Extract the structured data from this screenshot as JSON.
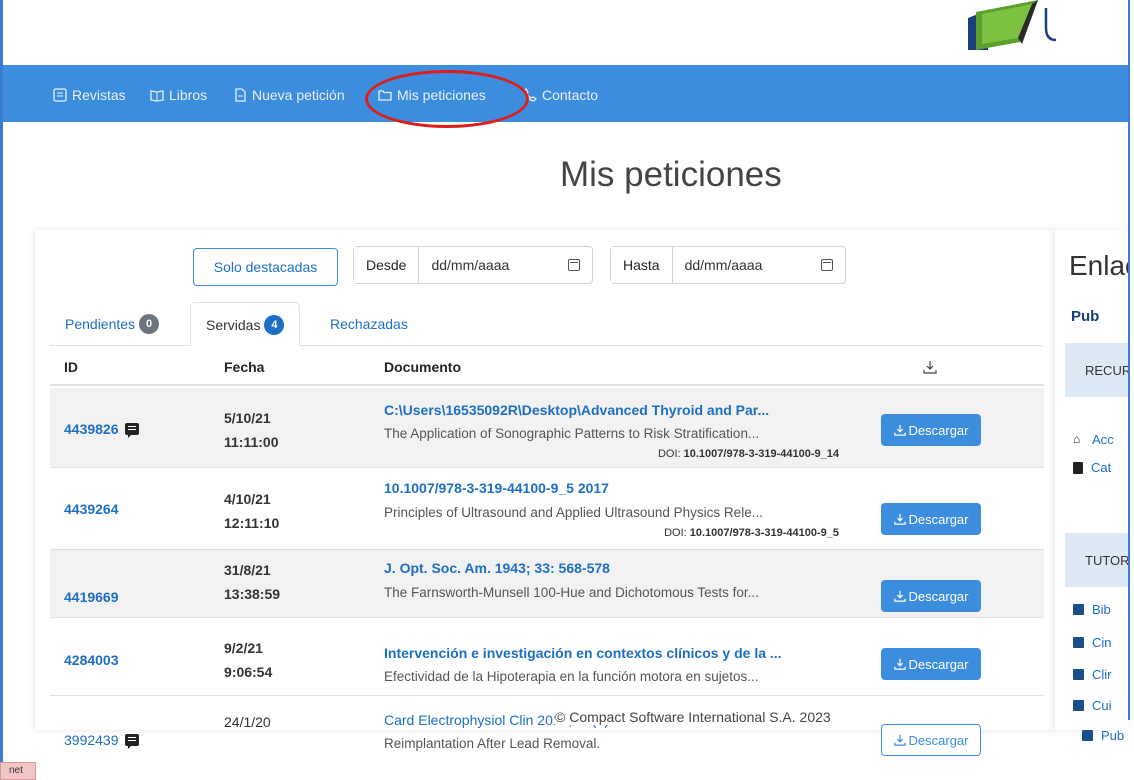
{
  "nav": {
    "items": [
      {
        "label": "Revistas",
        "icon": "journal-icon"
      },
      {
        "label": "Libros",
        "icon": "book-open-icon"
      },
      {
        "label": "Nueva petición",
        "icon": "file-icon"
      },
      {
        "label": "Mis peticiones",
        "icon": "folder-icon"
      },
      {
        "label": "Contacto",
        "icon": "phone-icon"
      }
    ]
  },
  "page": {
    "title": "Mis peticiones"
  },
  "filters": {
    "solo_destacadas": "Solo destacadas",
    "desde_label": "Desde",
    "desde_placeholder": "dd/mm/aaaa",
    "hasta_label": "Hasta",
    "hasta_placeholder": "dd/mm/aaaa"
  },
  "tabs": [
    {
      "label": "Pendientes",
      "count": "0"
    },
    {
      "label": "Servidas",
      "count": "4"
    },
    {
      "label": "Rechazadas",
      "count": ""
    }
  ],
  "table": {
    "headers": {
      "id": "ID",
      "fecha": "Fecha",
      "documento": "Documento"
    },
    "download_label": "Descargar",
    "rows": [
      {
        "id": "4439826",
        "date": "5/10/21",
        "time": "11:11:00",
        "title": "C:\\Users\\16535092R\\Desktop\\Advanced Thyroid and Par...",
        "subtitle": "The Application of Sonographic Patterns to Risk Stratification...",
        "doi_label": "DOI:",
        "doi": "10.1007/978-3-319-44100-9_14"
      },
      {
        "id": "4439264",
        "date": "4/10/21",
        "time": "12:11:10",
        "title": "10.1007/978-3-319-44100-9_5 2017",
        "subtitle": "Principles of Ultrasound and Applied Ultrasound Physics Rele...",
        "doi_label": "DOI:",
        "doi": "10.1007/978-3-319-44100-9_5"
      },
      {
        "id": "4419669",
        "date": "31/8/21",
        "time": "13:38:59",
        "title": "J. Opt. Soc. Am. 1943; 33: 568-578",
        "subtitle": "The Farnsworth-Munsell 100-Hue and Dichotomous Tests for..."
      },
      {
        "id": "4284003",
        "date": "9/2/21",
        "time": "9:06:54",
        "title": "Intervención e investigación en contextos clínicos y de la ...",
        "subtitle": "Efectividad de la Hipoterapia en la función motora en sujetos..."
      },
      {
        "id": "3992439",
        "date": "24/1/20",
        "time": "",
        "title": "Card Electrophysiol Clin 2018; 10(4): 667-674",
        "subtitle": "Reimplantation After Lead Removal."
      }
    ]
  },
  "sidebar": {
    "title": "Enlac",
    "pub": "Pub",
    "band1": "RECUR",
    "links1": [
      "Acc",
      "Cat"
    ],
    "band2": "TUTOR",
    "links2": [
      "Bib",
      "Cin",
      "Clir",
      "Cui",
      "Pub"
    ]
  },
  "footer": {
    "text": "© Compact Software International S.A. 2023"
  },
  "misc": {
    "net_tag": "net"
  }
}
